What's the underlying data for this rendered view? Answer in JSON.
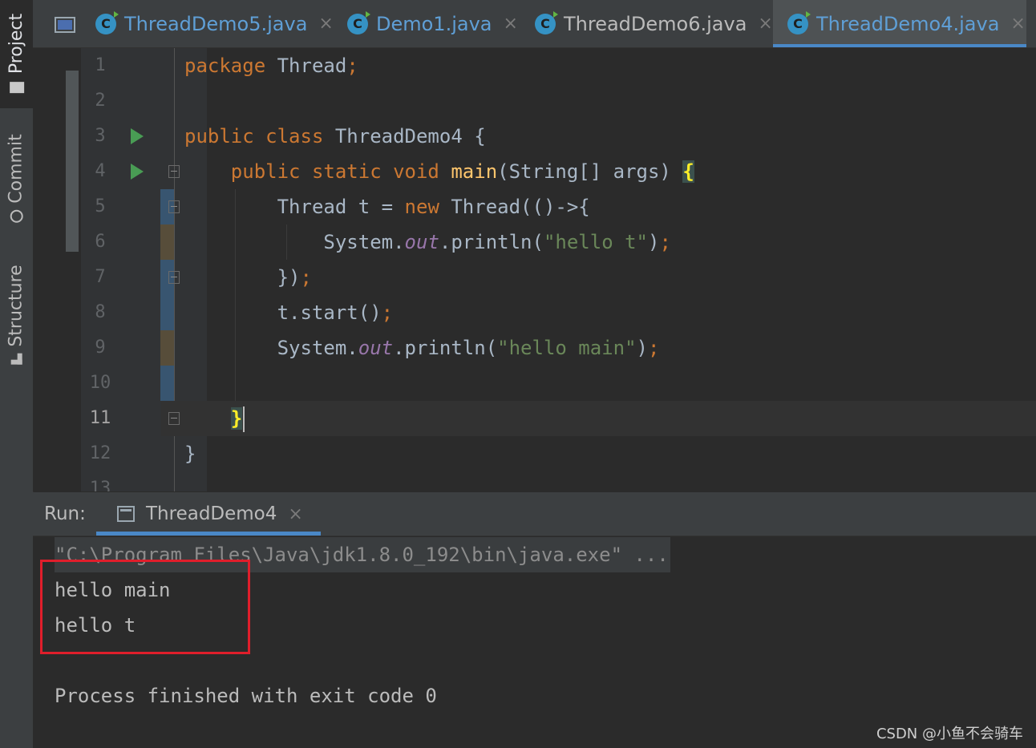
{
  "side_tabs": [
    {
      "label": "Project",
      "icon": "folder-icon"
    },
    {
      "label": "Commit",
      "icon": "commit-icon"
    },
    {
      "label": "Structure",
      "icon": "structure-icon"
    }
  ],
  "tabs": [
    {
      "name": "ThreadDemo5.java",
      "close": "×",
      "active": false
    },
    {
      "name": "Demo1.java",
      "close": "×",
      "active": false
    },
    {
      "name": "ThreadDemo6.java",
      "close": "×",
      "active": false
    },
    {
      "name": "ThreadDemo4.java",
      "close": "×",
      "active": true
    }
  ],
  "editor": {
    "current_line": 11,
    "lines": [
      {
        "num": "1",
        "code": [
          {
            "t": "package",
            "c": "kw"
          },
          {
            "t": " Thread"
          },
          {
            "t": ";",
            "c": "kw"
          }
        ]
      },
      {
        "num": "2",
        "code": []
      },
      {
        "num": "3",
        "run": true,
        "code": [
          {
            "t": "public class",
            "c": "kw"
          },
          {
            "t": " ThreadDemo4 {"
          }
        ]
      },
      {
        "num": "4",
        "run": true,
        "code": [
          {
            "t": "    "
          },
          {
            "t": "public static void",
            "c": "kw"
          },
          {
            "t": " "
          },
          {
            "t": "main",
            "c": "fn"
          },
          {
            "t": "(String[] args) "
          },
          {
            "t": "{",
            "c": "brace-hl"
          }
        ]
      },
      {
        "num": "5",
        "code": [
          {
            "t": "        Thread t = "
          },
          {
            "t": "new",
            "c": "kw"
          },
          {
            "t": " Thread(()->{"
          }
        ]
      },
      {
        "num": "6",
        "code": [
          {
            "t": "            System."
          },
          {
            "t": "out",
            "c": "fld"
          },
          {
            "t": ".println("
          },
          {
            "t": "\"hello t\"",
            "c": "str"
          },
          {
            "t": ")"
          },
          {
            "t": ";",
            "c": "kw"
          }
        ]
      },
      {
        "num": "7",
        "code": [
          {
            "t": "        })"
          },
          {
            "t": ";",
            "c": "kw"
          }
        ]
      },
      {
        "num": "8",
        "code": [
          {
            "t": "        t.start()"
          },
          {
            "t": ";",
            "c": "kw"
          }
        ]
      },
      {
        "num": "9",
        "code": [
          {
            "t": "        System."
          },
          {
            "t": "out",
            "c": "fld"
          },
          {
            "t": ".println("
          },
          {
            "t": "\"hello main\"",
            "c": "str"
          },
          {
            "t": ")"
          },
          {
            "t": ";",
            "c": "kw"
          }
        ]
      },
      {
        "num": "10",
        "code": []
      },
      {
        "num": "11",
        "code": [
          {
            "t": "    "
          },
          {
            "t": "}",
            "c": "brace-hl"
          }
        ],
        "caret": true
      },
      {
        "num": "12",
        "code": [
          {
            "t": "}"
          }
        ]
      },
      {
        "num": "13",
        "code": []
      }
    ]
  },
  "run": {
    "label": "Run:",
    "tab_name": "ThreadDemo4",
    "tab_close": "×",
    "console": [
      "\"C:\\Program Files\\Java\\jdk1.8.0_192\\bin\\java.exe\" ...",
      "hello main",
      "hello t",
      "",
      "Process finished with exit code 0"
    ]
  },
  "watermark": "CSDN @小鱼不会骑车",
  "colors": {
    "keyword": "#cc7832",
    "string": "#6a8759",
    "field": "#9876aa",
    "method": "#ffc66d",
    "accent": "#4a88c7",
    "highlight_box": "#e01e2b"
  }
}
